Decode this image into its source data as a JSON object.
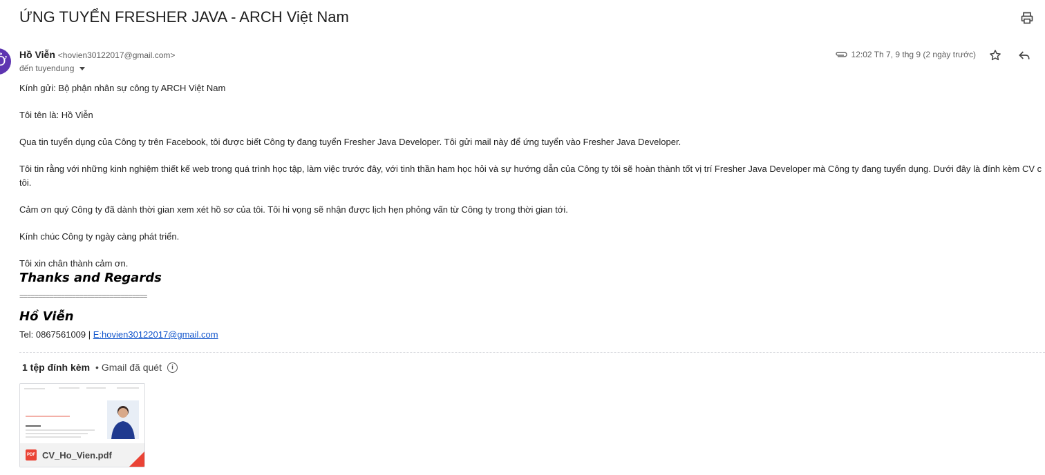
{
  "email": {
    "subject": "ỨNG TUYỂN FRESHER JAVA - ARCH Việt Nam",
    "avatar_letter": "Ở",
    "sender_name": "Hồ Viễn",
    "sender_email": "<hovien30122017@gmail.com>",
    "recipient": "đến tuyendung",
    "timestamp": "12:02 Th 7, 9 thg 9 (2 ngày trước)",
    "body": {
      "p1": "Kính gửi: Bộ phận nhân sự công ty ARCH Việt Nam",
      "p2": "Tôi tên là: Hồ Viễn",
      "p3": "Qua tin tuyển dụng của Công ty trên Facebook, tôi được biết Công ty đang tuyển Fresher Java Developer. Tôi gửi mail này để ứng tuyển vào Fresher Java Developer.",
      "p4": "Tôi tin rằng với những kinh nghiệm thiết kế web trong quá trình học tập, làm việc trước đây, với tinh thần ham học hỏi và sự hướng dẫn của Công ty tôi sẽ hoàn thành tốt vị trí Fresher Java  Developer mà Công ty đang tuyển dụng. Dưới đây là đính kèm CV c",
      "p4b": "tôi.",
      "p5": "Cảm ơn quý Công ty đã dành thời gian xem xét hồ sơ của tôi. Tôi hi vọng sẽ nhận được lịch hẹn phỏng vấn từ Công ty trong thời gian tới.",
      "p6": "Kính chúc Công ty ngày càng phát triển.",
      "p7": "Tôi xin chân thành cảm ơn."
    },
    "signature": {
      "thanks": "Thanks and Regards",
      "rule": "==================================",
      "name": "Hồ Viễn",
      "tel": "Tel: 0867561009 | ",
      "email_link": "E:hovien30122017@gmail.com"
    },
    "attachments": {
      "count_label": "1 tệp đính kèm",
      "scan_label": "• Gmail đã quét",
      "info_glyph": "i",
      "file_name": "CV_Ho_Vien.pdf",
      "file_badge": "PDF"
    }
  },
  "colors": {
    "avatar": "#5e35b1",
    "link": "#1155cc",
    "pdf_red": "#ea4335"
  }
}
